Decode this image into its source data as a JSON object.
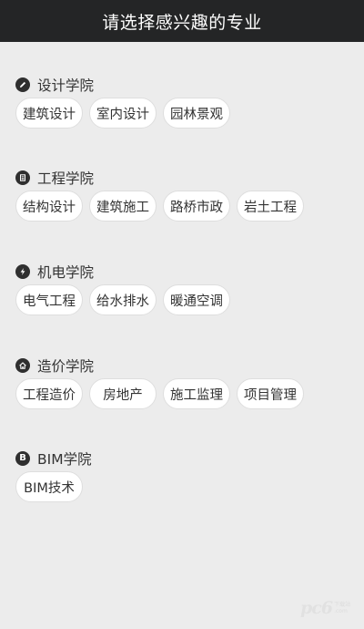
{
  "header": {
    "title": "请选择感兴趣的专业"
  },
  "sections": [
    {
      "title": "设计学院",
      "icon": "pencil-icon",
      "items": [
        "建筑设计",
        "室内设计",
        "园林景观"
      ]
    },
    {
      "title": "工程学院",
      "icon": "document-icon",
      "items": [
        "结构设计",
        "建筑施工",
        "路桥市政",
        "岩土工程"
      ]
    },
    {
      "title": "机电学院",
      "icon": "lightning-icon",
      "items": [
        "电气工程",
        "给水排水",
        "暖通空调"
      ]
    },
    {
      "title": "造价学院",
      "icon": "house-icon",
      "items": [
        "工程造价",
        "房地产",
        "施工监理",
        "项目管理"
      ]
    },
    {
      "title": "BIM学院",
      "icon": "letter-b-icon",
      "icon_letter": "B",
      "items": [
        "BIM技术"
      ]
    }
  ],
  "watermark": {
    "logo": "pc6",
    "line1": "下载站",
    "line2": ".com"
  },
  "colors": {
    "header_bg": "#242526",
    "page_bg": "#ececec",
    "chip_bg": "#ffffff",
    "icon_bg": "#2f2f2f"
  }
}
